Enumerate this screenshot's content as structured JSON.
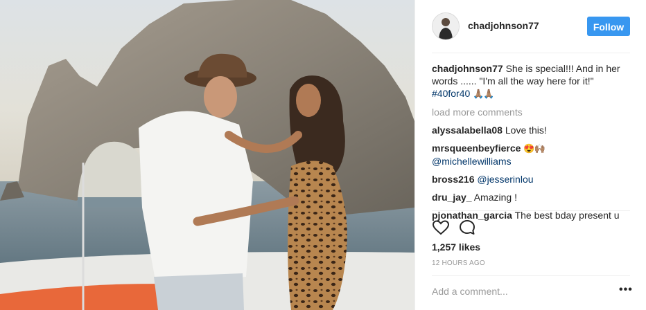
{
  "header": {
    "username": "chadjohnson77",
    "follow_label": "Follow"
  },
  "caption": {
    "username": "chadjohnson77",
    "text": "She is special!!! And in her words ...... \"I'm all the way here for it!\"",
    "hashtag": "#40for40",
    "emoji": "🙏🏽🙏🏽"
  },
  "load_more_label": "load more comments",
  "comments": [
    {
      "username": "alyssalabella08",
      "text": "Love this!"
    },
    {
      "username": "mrsqueenbeyfierce",
      "text": "😍🙌🏽",
      "mention": "@michellewilliams"
    },
    {
      "username": "bross216",
      "mention": "@jesserinlou"
    },
    {
      "username": "dru_jay_",
      "text": "Amazing !"
    },
    {
      "username": "pjonathan_garcia",
      "text": "The best bday present u"
    }
  ],
  "likes_text": "1,257 likes",
  "timestamp": "12 HOURS AGO",
  "add_comment_placeholder": "Add a comment...",
  "more_options_label": "•••",
  "icons": {
    "like": "heart-icon",
    "comment": "comment-icon",
    "more": "more-options-icon"
  },
  "colors": {
    "follow_button": "#3897f0",
    "hashtag": "#003569",
    "muted": "#999999"
  }
}
